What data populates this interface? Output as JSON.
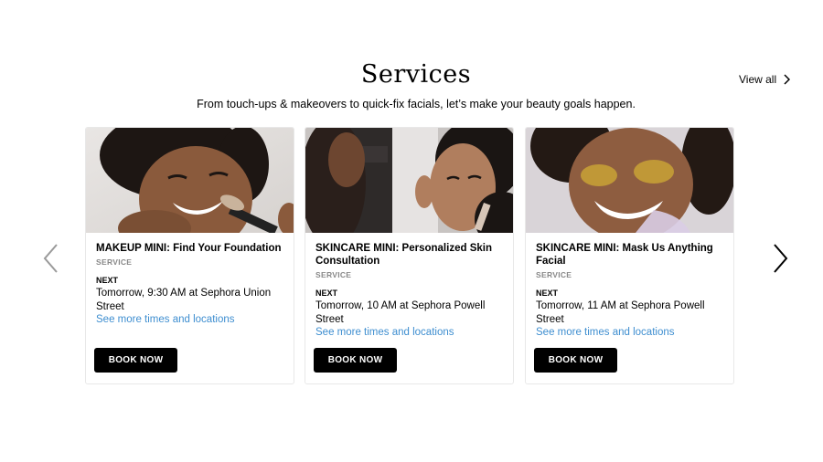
{
  "header": {
    "title": "Services",
    "subtitle": "From touch-ups & makeovers to quick-fix facials, let’s make your beauty goals happen.",
    "view_all_label": "View all"
  },
  "carousel": {
    "prev_icon": "chevron-left-icon",
    "next_icon": "chevron-right-icon"
  },
  "cards": [
    {
      "title": "MAKEUP MINI: Find Your Foundation",
      "type": "SERVICE",
      "next_label": "NEXT",
      "time": "Tomorrow, 9:30 AM at Sephora Union Street",
      "link": "See more times and locations",
      "button": "BOOK NOW",
      "image": "woman-makeup-brush-photo"
    },
    {
      "title": "SKINCARE MINI: Personalized Skin Consultation",
      "type": "SERVICE",
      "next_label": "NEXT",
      "time": "Tomorrow, 10 AM at Sephora Powell Street",
      "link": "See more times and locations",
      "button": "BOOK NOW",
      "image": "skincare-consultation-photo"
    },
    {
      "title": "SKINCARE MINI: Mask Us Anything Facial",
      "type": "SERVICE",
      "next_label": "NEXT",
      "time": "Tomorrow, 11 AM at Sephora Powell Street",
      "link": "See more times and locations",
      "button": "BOOK NOW",
      "image": "face-mask-photo"
    }
  ],
  "colors": {
    "link": "#3e8ed0",
    "button_bg": "#000000",
    "muted_text": "#888888"
  }
}
